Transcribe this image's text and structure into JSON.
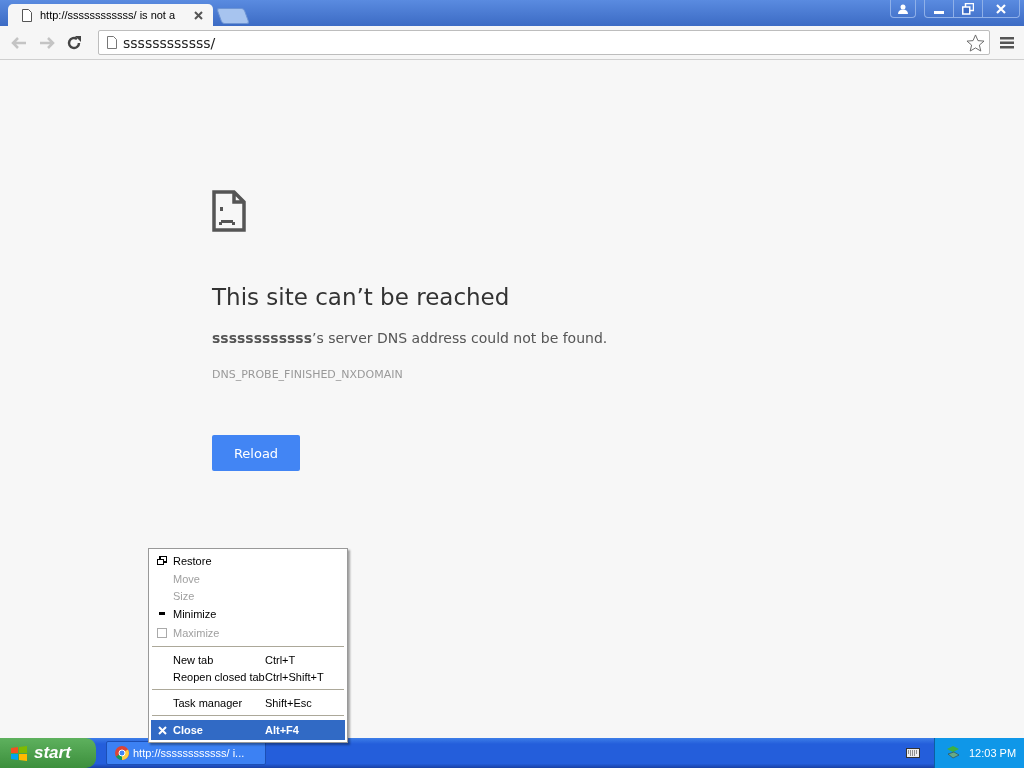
{
  "tabs": [
    {
      "title": "http://ssssssssssss/ is not a",
      "selected": true
    },
    {
      "selected": false
    }
  ],
  "toolbar": {
    "address": "ssssssssssss/"
  },
  "error": {
    "heading": "This site can’t be reached",
    "message": "**ssssssssssss**’s server DNS address could not be found.",
    "code": "DNS_PROBE_FINISHED_NXDOMAIN",
    "button": "Reload"
  },
  "menu": [
    {
      "kind": "restore",
      "label": "Restore",
      "disabled": false,
      "selected": false
    },
    {
      "kind": "plain",
      "label": "Move",
      "disabled": true,
      "selected": false
    },
    {
      "kind": "plain",
      "label": "Size",
      "disabled": true,
      "selected": false
    },
    {
      "kind": "minimize",
      "label": "Minimize",
      "disabled": false,
      "selected": false
    },
    {
      "kind": "maximize",
      "label": "Maximize",
      "disabled": true,
      "selected": false
    },
    {
      "kind": "separator"
    },
    {
      "kind": "plain",
      "label": "New tab",
      "shortcut": "Ctrl+T",
      "disabled": false,
      "selected": false
    },
    {
      "kind": "plain",
      "label": "Reopen closed tab",
      "shortcut": "Ctrl+Shift+T",
      "disabled": false,
      "selected": false
    },
    {
      "kind": "separator"
    },
    {
      "kind": "plain",
      "label": "Task manager",
      "shortcut": "Shift+Esc",
      "disabled": false,
      "selected": false
    },
    {
      "kind": "separator"
    },
    {
      "kind": "close",
      "label": "Close",
      "shortcut": "Alt+F4",
      "disabled": false,
      "selected": true
    }
  ],
  "taskbar": {
    "start": "start",
    "task": "http://ssssssssssss/ i...",
    "clock": "12:03 PM"
  }
}
